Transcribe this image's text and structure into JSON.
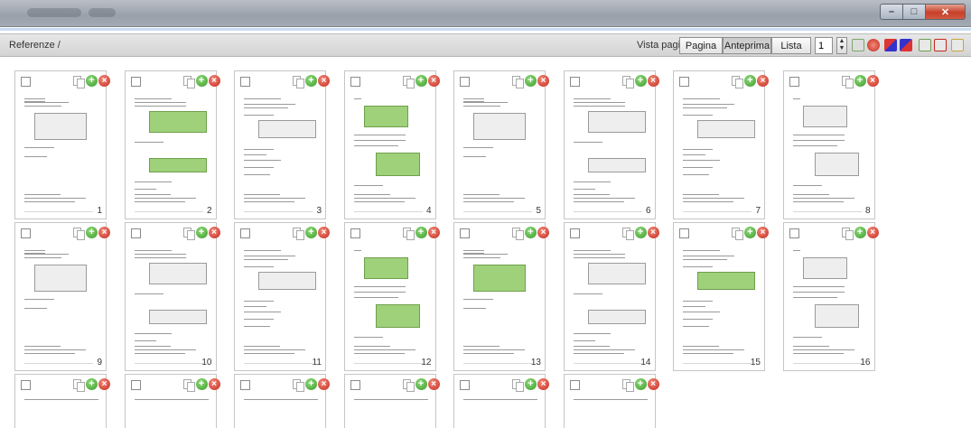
{
  "toolbar": {
    "breadcrumb": "Referenze /",
    "view_label": "Vista pagine",
    "view_buttons": [
      "Pagina",
      "Anteprima",
      "Lista"
    ],
    "active_view": "Anteprima",
    "page_input": "1"
  },
  "toolbar_icons": [
    "insert-page-icon",
    "delete-page-icon",
    "move-page-left-icon",
    "move-page-right-icon",
    "import-icon",
    "export-icon",
    "merge-icon"
  ],
  "window_buttons": {
    "minimize": "–",
    "maximize": "□",
    "close": "✕"
  },
  "thumbnails": [
    {
      "page": "1",
      "green": false
    },
    {
      "page": "2",
      "green": true
    },
    {
      "page": "3",
      "green": false
    },
    {
      "page": "4",
      "green": true
    },
    {
      "page": "5",
      "green": false
    },
    {
      "page": "6",
      "green": false
    },
    {
      "page": "7",
      "green": false
    },
    {
      "page": "8",
      "green": false
    },
    {
      "page": "9",
      "green": false
    },
    {
      "page": "10",
      "green": false
    },
    {
      "page": "11",
      "green": false
    },
    {
      "page": "12",
      "green": true
    },
    {
      "page": "13",
      "green": true
    },
    {
      "page": "14",
      "green": false
    },
    {
      "page": "15",
      "green": true
    },
    {
      "page": "16",
      "green": false
    },
    {
      "page": "",
      "green": false
    },
    {
      "page": "",
      "green": false
    },
    {
      "page": "",
      "green": false
    },
    {
      "page": "",
      "green": false
    },
    {
      "page": "",
      "green": false
    },
    {
      "page": "",
      "green": false
    }
  ],
  "colors": {
    "add": "#3a9a2a",
    "delete": "#c7281b",
    "titlebar": "#a3a9b2"
  }
}
